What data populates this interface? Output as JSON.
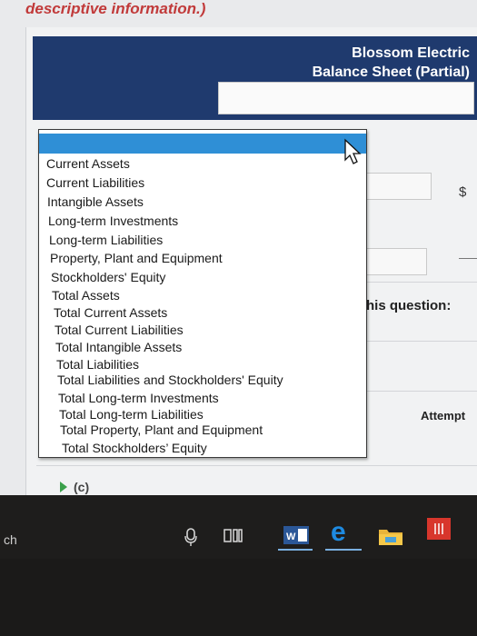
{
  "page": {
    "heading": "descriptive information.)"
  },
  "statement": {
    "company": "Blossom Electric",
    "title": "Balance Sheet (Partial)",
    "currency_symbol": "$"
  },
  "side_text": {
    "question": "this question:",
    "attempts": "Attempt",
    "section_label": "(c)"
  },
  "dropdown": {
    "selected": "",
    "options": [
      "Current Assets",
      "Current Liabilities",
      "Intangible Assets",
      "Long-term Investments",
      "Long-term Liabilities",
      "Property, Plant and Equipment",
      "Stockholders' Equity",
      "Total Assets",
      "Total Current Assets",
      "Total Current Liabilities",
      "Total Intangible Assets",
      "Total Liabilities",
      "Total Liabilities and Stockholders' Equity",
      "Total Long-term Investments",
      "Total Long-term Liabilities",
      "Total Property, Plant and Equipment",
      "Total Stockholders’ Equity"
    ]
  },
  "taskbar": {
    "search_text": "ch",
    "icons": [
      "cortana-mic-icon",
      "task-view-icon",
      "word-icon",
      "edge-icon",
      "file-explorer-icon",
      "app-icon"
    ]
  },
  "colors": {
    "header_band": "#1f3a6e",
    "highlight": "#2f8fd6",
    "heading_red": "#c13a3a",
    "taskbar": "#1e1d1c"
  }
}
